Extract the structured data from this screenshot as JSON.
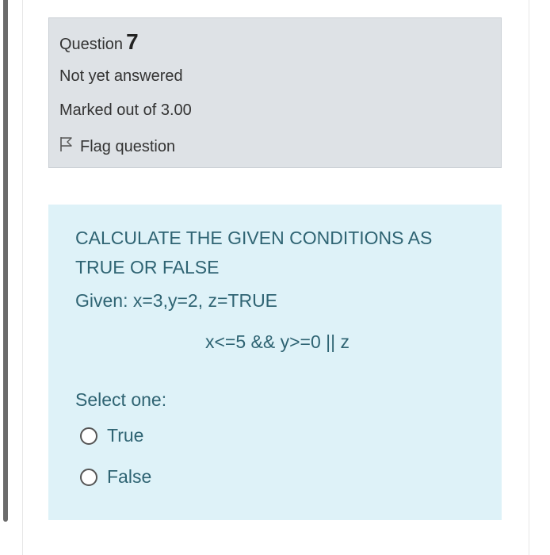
{
  "question_info": {
    "label": "Question",
    "number": "7",
    "state": "Not yet answered",
    "grade": "Marked out of 3.00",
    "flag_label": "Flag question"
  },
  "question": {
    "text": "CALCULATE THE GIVEN CONDITIONS AS TRUE OR FALSE",
    "given": "Given: x=3,y=2, z=TRUE",
    "expression": "x<=5 && y>=0 || z",
    "prompt": "Select one:",
    "options": [
      {
        "label": "True"
      },
      {
        "label": "False"
      }
    ]
  },
  "colors": {
    "info_bg": "#dee2e6",
    "content_bg": "#def2f8",
    "content_text": "#2f6473"
  }
}
